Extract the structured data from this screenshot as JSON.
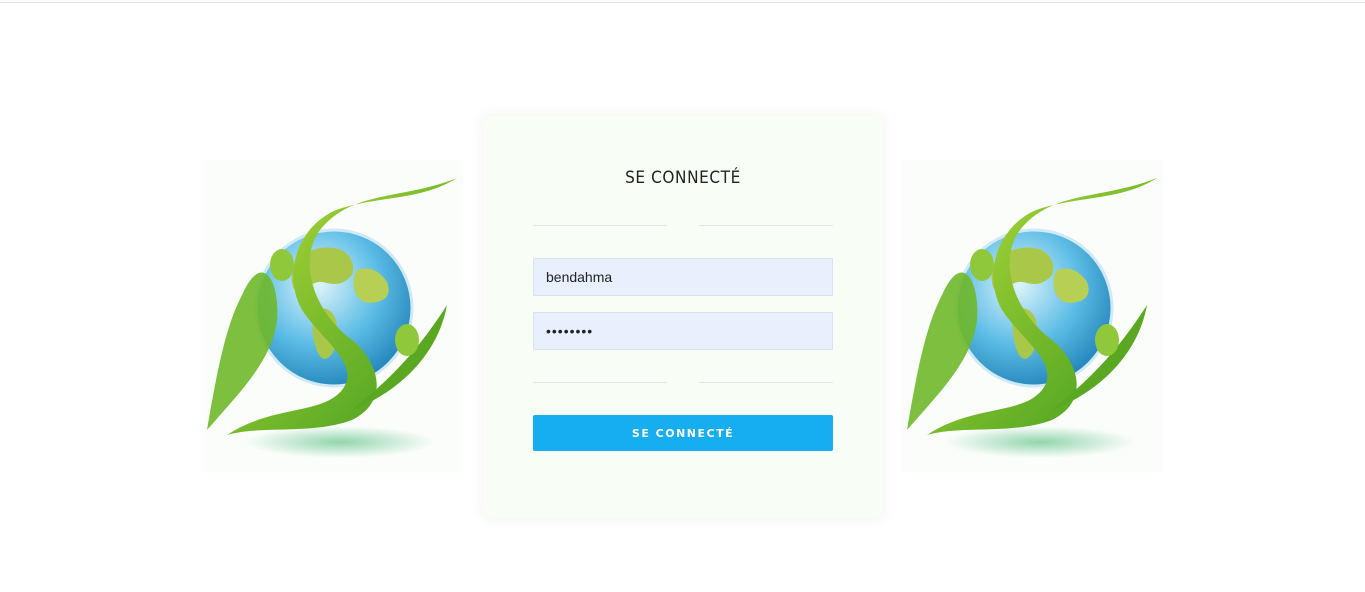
{
  "login": {
    "title": "SE CONNECTÉ",
    "username_value": "bendahma",
    "password_value": "••••••••",
    "submit_label": "SE CONNECTÉ"
  },
  "logos": {
    "left": "globe-leaf-logo",
    "right": "globe-leaf-logo"
  },
  "colors": {
    "accent": "#17aef0",
    "input_bg": "#e8f0fe",
    "card_bg": "#f8fdf5",
    "leaf_green": "#7cbf2a",
    "globe_blue": "#3aa7d8"
  }
}
